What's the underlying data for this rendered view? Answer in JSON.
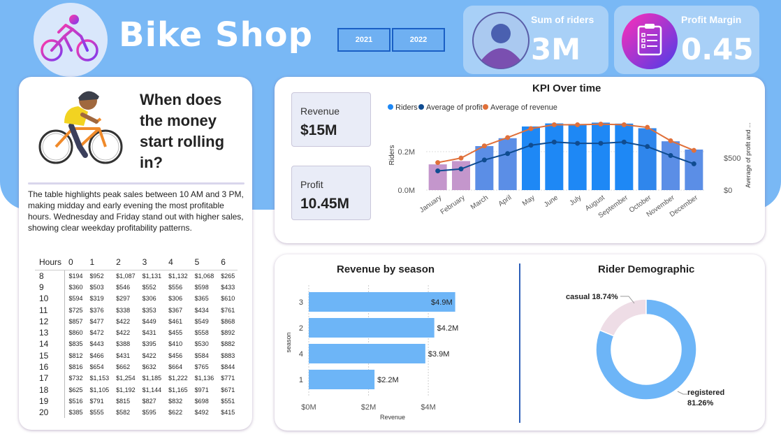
{
  "header": {
    "title": "Bike Shop",
    "year_buttons": [
      "2021",
      "2022"
    ],
    "riders_card": {
      "label": "Sum of riders",
      "value": "3M"
    },
    "margin_card": {
      "label": "Profit Margin",
      "value": "0.45"
    }
  },
  "left_panel": {
    "question": "When does the money start rolling in?",
    "description": "The table highlights peak sales between 10 AM and 3 PM, making midday and early evening the most profitable hours. Wednesday and Friday stand out with higher sales, showing clear weekday profitability patterns.",
    "table": {
      "corner": "Hours",
      "columns": [
        "0",
        "1",
        "2",
        "3",
        "4",
        "5",
        "6"
      ],
      "rows": [
        {
          "hour": "8",
          "values": [
            "$194",
            "$952",
            "$1,087",
            "$1,131",
            "$1,132",
            "$1,068",
            "$265"
          ]
        },
        {
          "hour": "9",
          "values": [
            "$360",
            "$503",
            "$546",
            "$552",
            "$556",
            "$598",
            "$433"
          ]
        },
        {
          "hour": "10",
          "values": [
            "$594",
            "$319",
            "$297",
            "$306",
            "$306",
            "$365",
            "$610"
          ]
        },
        {
          "hour": "11",
          "values": [
            "$725",
            "$376",
            "$338",
            "$353",
            "$367",
            "$434",
            "$761"
          ]
        },
        {
          "hour": "12",
          "values": [
            "$857",
            "$477",
            "$422",
            "$449",
            "$461",
            "$549",
            "$868"
          ]
        },
        {
          "hour": "13",
          "values": [
            "$860",
            "$472",
            "$422",
            "$431",
            "$455",
            "$558",
            "$892"
          ]
        },
        {
          "hour": "14",
          "values": [
            "$835",
            "$443",
            "$388",
            "$395",
            "$410",
            "$530",
            "$882"
          ]
        },
        {
          "hour": "15",
          "values": [
            "$812",
            "$466",
            "$431",
            "$422",
            "$456",
            "$584",
            "$883"
          ]
        },
        {
          "hour": "16",
          "values": [
            "$816",
            "$654",
            "$662",
            "$632",
            "$664",
            "$765",
            "$844"
          ]
        },
        {
          "hour": "17",
          "values": [
            "$732",
            "$1,153",
            "$1,254",
            "$1,185",
            "$1,222",
            "$1,136",
            "$771"
          ]
        },
        {
          "hour": "18",
          "values": [
            "$625",
            "$1,105",
            "$1,192",
            "$1,144",
            "$1,165",
            "$971",
            "$671"
          ]
        },
        {
          "hour": "19",
          "values": [
            "$516",
            "$791",
            "$815",
            "$827",
            "$832",
            "$698",
            "$551"
          ]
        },
        {
          "hour": "20",
          "values": [
            "$385",
            "$555",
            "$582",
            "$595",
            "$622",
            "$492",
            "$415"
          ]
        }
      ]
    }
  },
  "stats": {
    "revenue": {
      "label": "Revenue",
      "value": "$15M"
    },
    "profit": {
      "label": "Profit",
      "value": "10.45M"
    }
  },
  "colors": {
    "header_bg": "#79b8f5",
    "riders_blue": "#1e88f5",
    "profit_navy": "#0f4c91",
    "revenue_orange": "#e0703a",
    "bar_light_blue": "#6db5f7",
    "donut_pink": "#eedde6"
  },
  "chart_data": [
    {
      "type": "bar",
      "title": "KPI Over time",
      "legend": [
        "Riders",
        "Average of profit",
        "Average of revenue"
      ],
      "legend_position": "top",
      "categories": [
        "January",
        "February",
        "March",
        "April",
        "May",
        "June",
        "July",
        "August",
        "September",
        "October",
        "November",
        "December"
      ],
      "series": [
        {
          "name": "Riders",
          "axis": "left",
          "values": [
            0.134,
            0.151,
            0.229,
            0.27,
            0.331,
            0.347,
            0.344,
            0.351,
            0.346,
            0.322,
            0.254,
            0.211
          ]
        },
        {
          "name": "Average of profit",
          "axis": "right",
          "values": [
            300,
            330,
            470,
            570,
            700,
            750,
            730,
            730,
            750,
            680,
            540,
            410
          ]
        },
        {
          "name": "Average of revenue",
          "axis": "right",
          "values": [
            430,
            500,
            690,
            820,
            960,
            1020,
            1020,
            1030,
            1020,
            980,
            770,
            620
          ]
        }
      ],
      "ylabel": "Riders",
      "y2label": "Average of profit and ...",
      "yticks": [
        "0.0M",
        "0.2M"
      ],
      "y2ticks": [
        "$0",
        "$500"
      ],
      "ylim": [
        0,
        0.4
      ],
      "y2lim": [
        0,
        1200
      ]
    },
    {
      "type": "bar",
      "orientation": "horizontal",
      "title": "Revenue by season",
      "categories": [
        "3",
        "2",
        "4",
        "1"
      ],
      "values": [
        4.9,
        4.2,
        3.9,
        2.2
      ],
      "labels": [
        "$4.9M",
        "$4.2M",
        "$3.9M",
        "$2.2M"
      ],
      "xlabel": "Revenue",
      "ylabel": "season",
      "xticks": [
        "$0M",
        "$2M",
        "$4M"
      ],
      "xlim": [
        0,
        5
      ]
    },
    {
      "type": "pie",
      "donut": true,
      "title": "Rider Demographic",
      "slices": [
        {
          "name": "casual",
          "value": 18.74,
          "label": "18.74%"
        },
        {
          "name": "registered",
          "value": 81.26,
          "label": "81.26%"
        }
      ]
    }
  ]
}
